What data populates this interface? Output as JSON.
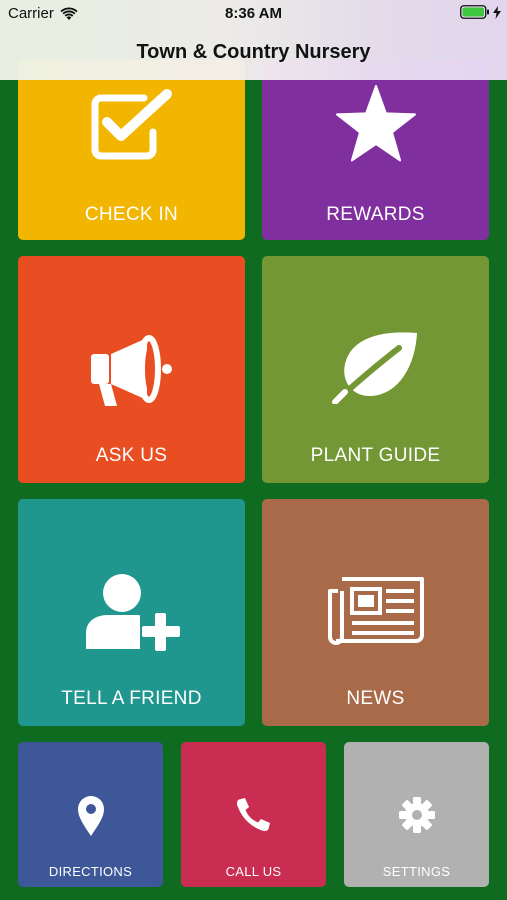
{
  "status_bar": {
    "carrier": "Carrier",
    "time": "8:36 AM"
  },
  "nav": {
    "title": "Town & Country Nursery"
  },
  "tiles": {
    "check_in": {
      "label": "CHECK IN",
      "icon": "checkbox-icon",
      "color": "#f2b600"
    },
    "rewards": {
      "label": "REWARDS",
      "icon": "star-icon",
      "color": "#7f2f9e"
    },
    "ask_us": {
      "label": "ASK US",
      "icon": "megaphone-icon",
      "color": "#e94e22"
    },
    "plant_guide": {
      "label": "PLANT GUIDE",
      "icon": "leaf-icon",
      "color": "#739734"
    },
    "tell_a_friend": {
      "label": "TELL A FRIEND",
      "icon": "add-user-icon",
      "color": "#1f968e"
    },
    "news": {
      "label": "NEWS",
      "icon": "newspaper-icon",
      "color": "#a86a48"
    },
    "directions": {
      "label": "DIRECTIONS",
      "icon": "map-pin-icon",
      "color": "#3d5798"
    },
    "call_us": {
      "label": "CALL US",
      "icon": "phone-icon",
      "color": "#c92d51"
    },
    "settings": {
      "label": "SETTINGS",
      "icon": "gear-icon",
      "color": "#b1b1b1"
    }
  },
  "colors": {
    "background": "#0f6b1f"
  }
}
